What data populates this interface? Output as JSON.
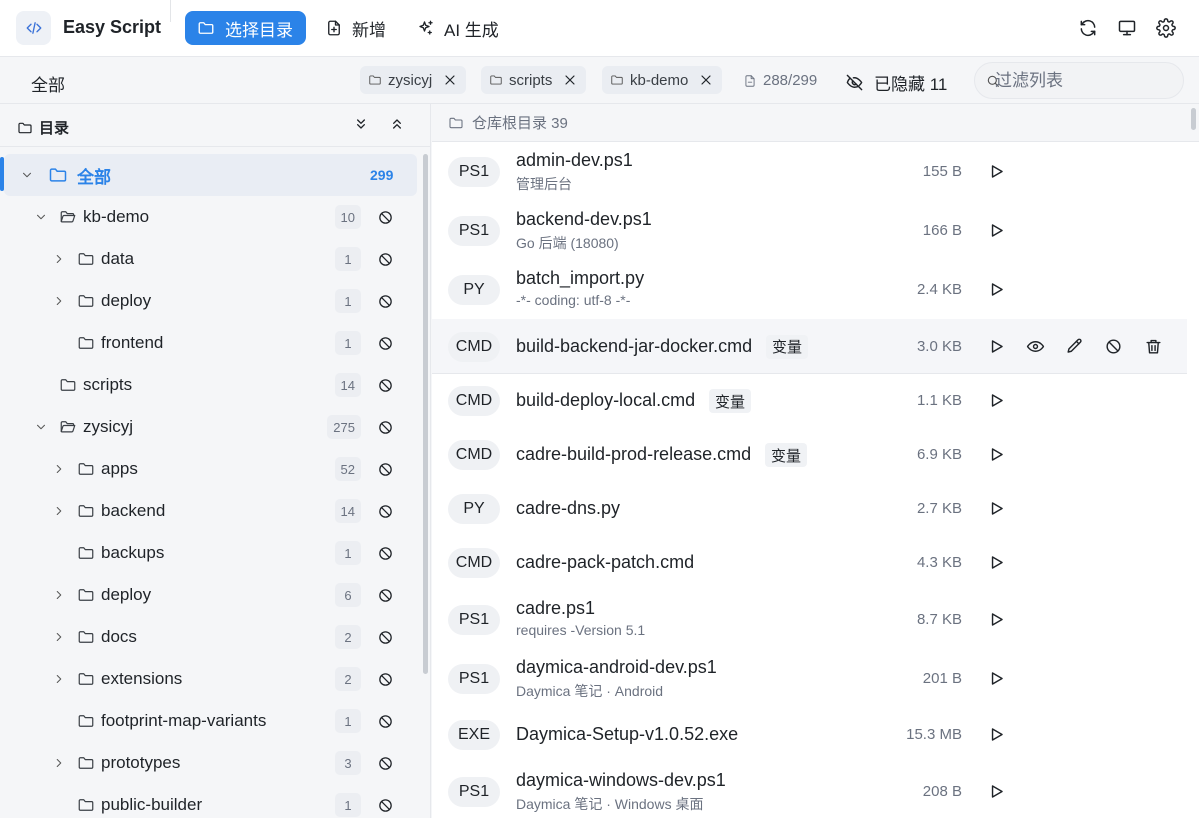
{
  "app": {
    "name": "Easy Script"
  },
  "toolbar": {
    "select_dir_label": "选择目录",
    "new_label": "新增",
    "ai_label": "AI 生成"
  },
  "filter": {
    "all_label": "全部",
    "chips": [
      {
        "label": "zysicyj"
      },
      {
        "label": "scripts"
      },
      {
        "label": "kb-demo"
      }
    ],
    "counter": "288/299",
    "hidden_label": "已隐藏 11",
    "search_placeholder": "过滤列表"
  },
  "sidebar": {
    "title": "目录",
    "tree": [
      {
        "label": "全部",
        "count": "299",
        "level": 0,
        "chevron": "down",
        "active": true
      },
      {
        "label": "kb-demo",
        "count": "10",
        "level": 1,
        "chevron": "down"
      },
      {
        "label": "data",
        "count": "1",
        "level": 2,
        "chevron": "right"
      },
      {
        "label": "deploy",
        "count": "1",
        "level": 2,
        "chevron": "right"
      },
      {
        "label": "frontend",
        "count": "1",
        "level": 2,
        "chevron": "none"
      },
      {
        "label": "scripts",
        "count": "14",
        "level": 1,
        "chevron": "none"
      },
      {
        "label": "zysicyj",
        "count": "275",
        "level": 1,
        "chevron": "down"
      },
      {
        "label": "apps",
        "count": "52",
        "level": 2,
        "chevron": "right"
      },
      {
        "label": "backend",
        "count": "14",
        "level": 2,
        "chevron": "right"
      },
      {
        "label": "backups",
        "count": "1",
        "level": 2,
        "chevron": "none"
      },
      {
        "label": "deploy",
        "count": "6",
        "level": 2,
        "chevron": "right"
      },
      {
        "label": "docs",
        "count": "2",
        "level": 2,
        "chevron": "right"
      },
      {
        "label": "extensions",
        "count": "2",
        "level": 2,
        "chevron": "right"
      },
      {
        "label": "footprint-map-variants",
        "count": "1",
        "level": 2,
        "chevron": "none"
      },
      {
        "label": "prototypes",
        "count": "3",
        "level": 2,
        "chevron": "right"
      },
      {
        "label": "public-builder",
        "count": "1",
        "level": 2,
        "chevron": "none"
      }
    ]
  },
  "main": {
    "header": "仓库根目录 39",
    "files": [
      {
        "type": "PS1",
        "name": "admin-dev.ps1",
        "desc": "管理后台",
        "size": "155 B",
        "tag": ""
      },
      {
        "type": "PS1",
        "name": "backend-dev.ps1",
        "desc": "Go 后端 (18080)",
        "size": "166 B",
        "tag": ""
      },
      {
        "type": "PY",
        "name": "batch_import.py",
        "desc": "-*- coding: utf-8 -*-",
        "size": "2.4 KB",
        "tag": ""
      },
      {
        "type": "CMD",
        "name": "build-backend-jar-docker.cmd",
        "desc": "",
        "size": "3.0 KB",
        "tag": "变量",
        "hover": true
      },
      {
        "type": "CMD",
        "name": "build-deploy-local.cmd",
        "desc": "",
        "size": "1.1 KB",
        "tag": "变量"
      },
      {
        "type": "CMD",
        "name": "cadre-build-prod-release.cmd",
        "desc": "",
        "size": "6.9 KB",
        "tag": "变量"
      },
      {
        "type": "PY",
        "name": "cadre-dns.py",
        "desc": "",
        "size": "2.7 KB",
        "tag": ""
      },
      {
        "type": "CMD",
        "name": "cadre-pack-patch.cmd",
        "desc": "",
        "size": "4.3 KB",
        "tag": ""
      },
      {
        "type": "PS1",
        "name": "cadre.ps1",
        "desc": "requires -Version 5.1",
        "size": "8.7 KB",
        "tag": ""
      },
      {
        "type": "PS1",
        "name": "daymica-android-dev.ps1",
        "desc": "Daymica 笔记 · Android",
        "size": "201 B",
        "tag": ""
      },
      {
        "type": "EXE",
        "name": "Daymica-Setup-v1.0.52.exe",
        "desc": "",
        "size": "15.3 MB",
        "tag": ""
      },
      {
        "type": "PS1",
        "name": "daymica-windows-dev.ps1",
        "desc": "Daymica 笔记 · Windows 桌面",
        "size": "208 B",
        "tag": ""
      }
    ]
  },
  "colors": {
    "accent": "#2b83e8",
    "muted": "#6b7280"
  }
}
